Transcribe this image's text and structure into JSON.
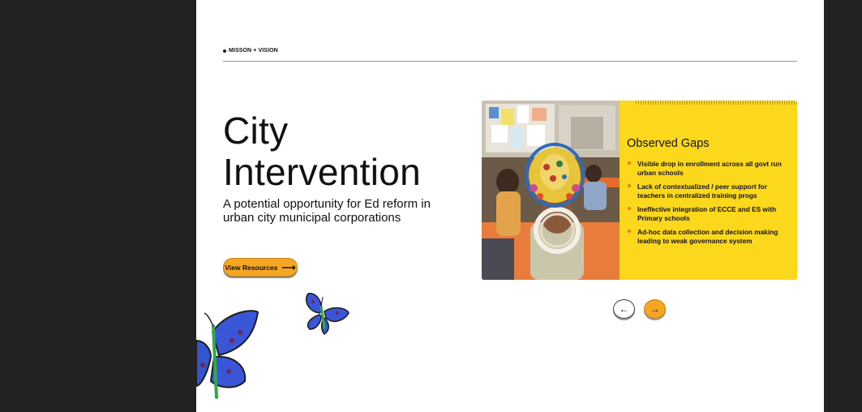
{
  "section": {
    "label": "MISSON + VISION"
  },
  "hero": {
    "title_line1": "City",
    "title_line2": "Intervention",
    "subtitle": "A potential opportunity for Ed reform in urban city municipal corporations",
    "button_label": "View Resources",
    "button_arrow": "⟶"
  },
  "card": {
    "title": "Observed Gaps",
    "items": [
      "Visible drop in enrollment across all govt run urban schools",
      "Lack of contextualized / peer support for teachers in centralized training progs",
      "Ineffective integration of ECCE and ES with Primary schools",
      "Ad-hoc data collection and decision making leading to weak governance system"
    ]
  },
  "carousel": {
    "prev_icon": "←",
    "next_icon": "→"
  },
  "colors": {
    "accent_orange": "#f5a623",
    "panel_yellow": "#fbd81c",
    "bullet_orange": "#f07c16",
    "butterfly_blue": "#3a55d6",
    "backdrop": "#222222"
  }
}
